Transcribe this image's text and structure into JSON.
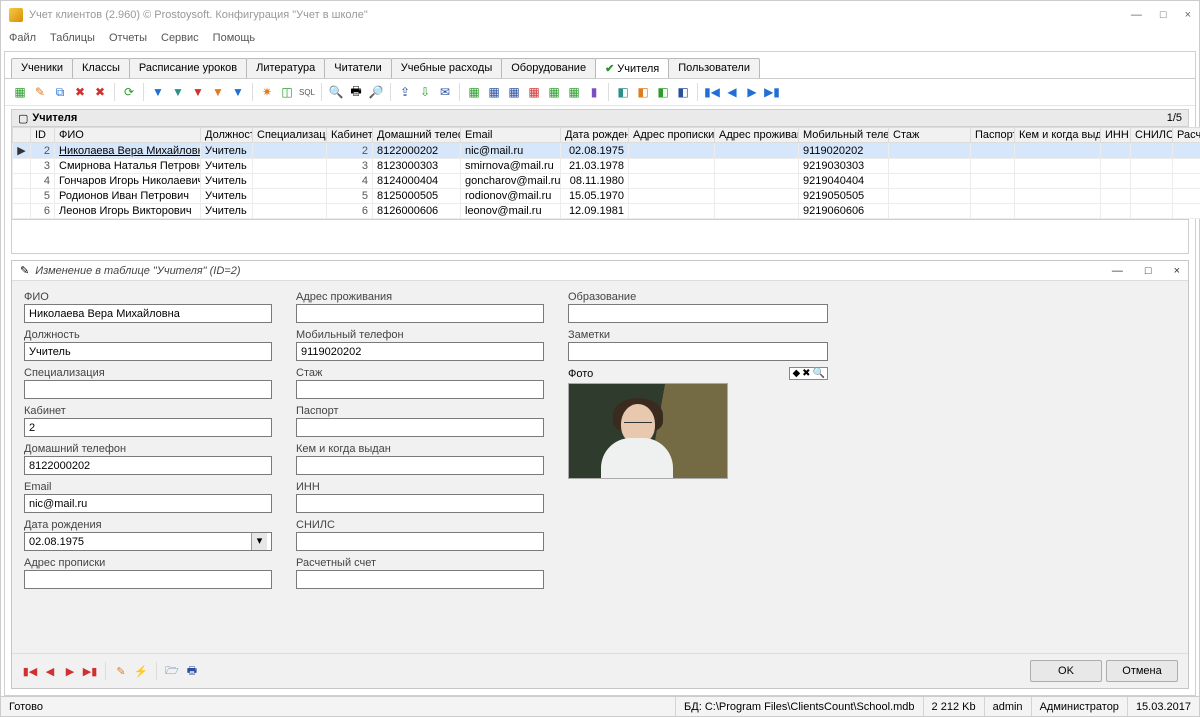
{
  "window": {
    "title": "Учет клиентов (2.960) © Prostoysoft. Конфигурация \"Учет в школе\"",
    "min": "—",
    "max": "□",
    "close": "×"
  },
  "menu": [
    "Файл",
    "Таблицы",
    "Отчеты",
    "Сервис",
    "Помощь"
  ],
  "tabs": [
    {
      "label": "Ученики"
    },
    {
      "label": "Классы"
    },
    {
      "label": "Расписание уроков"
    },
    {
      "label": "Литература"
    },
    {
      "label": "Читатели"
    },
    {
      "label": "Учебные расходы"
    },
    {
      "label": "Оборудование"
    },
    {
      "label": "Учителя",
      "active": true
    },
    {
      "label": "Пользователи"
    }
  ],
  "gridTitle": "Учителя",
  "pageIndicator": "1/5",
  "columns": [
    "",
    "ID",
    "ФИО",
    "Должность",
    "Специализация",
    "Кабинет",
    "Домашний телефон",
    "Email",
    "Дата рождения",
    "Адрес прописки",
    "Адрес проживания",
    "Мобильный телефон",
    "Стаж",
    "Паспорт",
    "Кем и когда выдан",
    "ИНН",
    "СНИЛС",
    "Расчетн"
  ],
  "rows": [
    {
      "sel": true,
      "id": "2",
      "fio": "Николаева Вера Михайловна",
      "dolzh": "Учитель",
      "spec": "",
      "kab": "2",
      "tel": "8122000202",
      "email": "nic@mail.ru",
      "dob": "02.08.1975",
      "adr1": "",
      "adr2": "",
      "mob": "9119020202",
      "stazh": ""
    },
    {
      "id": "3",
      "fio": "Смирнова Наталья Петровна",
      "dolzh": "Учитель",
      "spec": "",
      "kab": "3",
      "tel": "8123000303",
      "email": "smirnova@mail.ru",
      "dob": "21.03.1978",
      "adr1": "",
      "adr2": "",
      "mob": "9219030303",
      "stazh": ""
    },
    {
      "id": "4",
      "fio": "Гончаров Игорь Николаевич",
      "dolzh": "Учитель",
      "spec": "",
      "kab": "4",
      "tel": "8124000404",
      "email": "goncharov@mail.ru",
      "dob": "08.11.1980",
      "adr1": "",
      "adr2": "",
      "mob": "9219040404",
      "stazh": ""
    },
    {
      "id": "5",
      "fio": "Родионов Иван Петрович",
      "dolzh": "Учитель",
      "spec": "",
      "kab": "5",
      "tel": "8125000505",
      "email": "rodionov@mail.ru",
      "dob": "15.05.1970",
      "adr1": "",
      "adr2": "",
      "mob": "9219050505",
      "stazh": ""
    },
    {
      "id": "6",
      "fio": "Леонов Игорь Викторович",
      "dolzh": "Учитель",
      "spec": "",
      "kab": "6",
      "tel": "8126000606",
      "email": "leonov@mail.ru",
      "dob": "12.09.1981",
      "adr1": "",
      "adr2": "",
      "mob": "9219060606",
      "stazh": ""
    }
  ],
  "editTitle": "Изменение в таблице \"Учителя\" (ID=2)",
  "form": {
    "col1": [
      {
        "label": "ФИО",
        "value": "Николаева Вера Михайловна"
      },
      {
        "label": "Должность",
        "value": "Учитель"
      },
      {
        "label": "Специализация",
        "value": ""
      },
      {
        "label": "Кабинет",
        "value": "2"
      },
      {
        "label": "Домашний телефон",
        "value": "8122000202"
      },
      {
        "label": "Email",
        "value": "nic@mail.ru"
      },
      {
        "label": "Дата рождения",
        "value": "02.08.1975",
        "combo": true
      },
      {
        "label": "Адрес прописки",
        "value": ""
      }
    ],
    "col2": [
      {
        "label": "Адрес проживания",
        "value": ""
      },
      {
        "label": "Мобильный телефон",
        "value": "9119020202"
      },
      {
        "label": "Стаж",
        "value": ""
      },
      {
        "label": "Паспорт",
        "value": ""
      },
      {
        "label": "Кем и когда выдан",
        "value": ""
      },
      {
        "label": "ИНН",
        "value": ""
      },
      {
        "label": "СНИЛС",
        "value": ""
      },
      {
        "label": "Расчетный счет",
        "value": ""
      }
    ],
    "col3": [
      {
        "label": "Образование",
        "value": ""
      },
      {
        "label": "Заметки",
        "value": ""
      }
    ],
    "photoLabel": "Фото"
  },
  "buttons": {
    "ok": "OK",
    "cancel": "Отмена"
  },
  "status": {
    "ready": "Готово",
    "dbLabel": "БД:",
    "dbPath": "C:\\Program Files\\ClientsCount\\School.mdb",
    "size": "2 212 Kb",
    "user": "admin",
    "role": "Администратор",
    "date": "15.03.2017"
  }
}
